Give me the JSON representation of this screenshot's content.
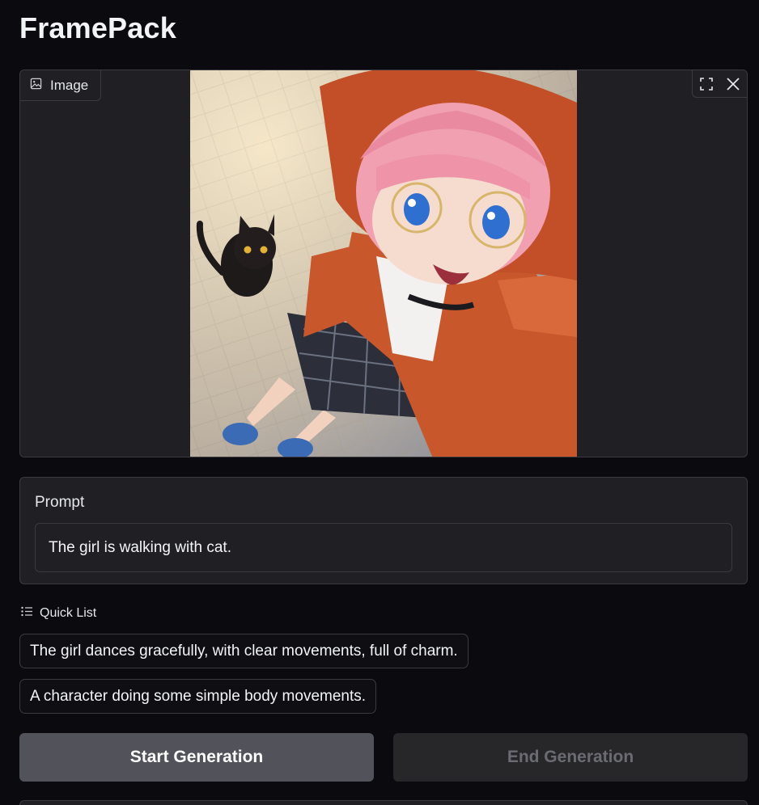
{
  "app": {
    "title": "FramePack"
  },
  "image_panel": {
    "label": "Image",
    "label_icon": "image-icon",
    "toolbar": [
      {
        "icon": "fullscreen-icon"
      },
      {
        "icon": "close-icon"
      }
    ]
  },
  "prompt": {
    "label": "Prompt",
    "value": "The girl is walking with cat."
  },
  "quick_list": {
    "label": "Quick List",
    "icon": "list-icon",
    "items": [
      "The girl dances gracefully, with clear movements, full of charm.",
      "A character doing some simple body movements."
    ]
  },
  "actions": {
    "start_label": "Start Generation",
    "end_label": "End Generation"
  },
  "colors": {
    "background": "#0b0b0f",
    "panel": "#202024",
    "border": "#3a3a40",
    "start_button": "#52525b",
    "end_button": "#27272a"
  }
}
